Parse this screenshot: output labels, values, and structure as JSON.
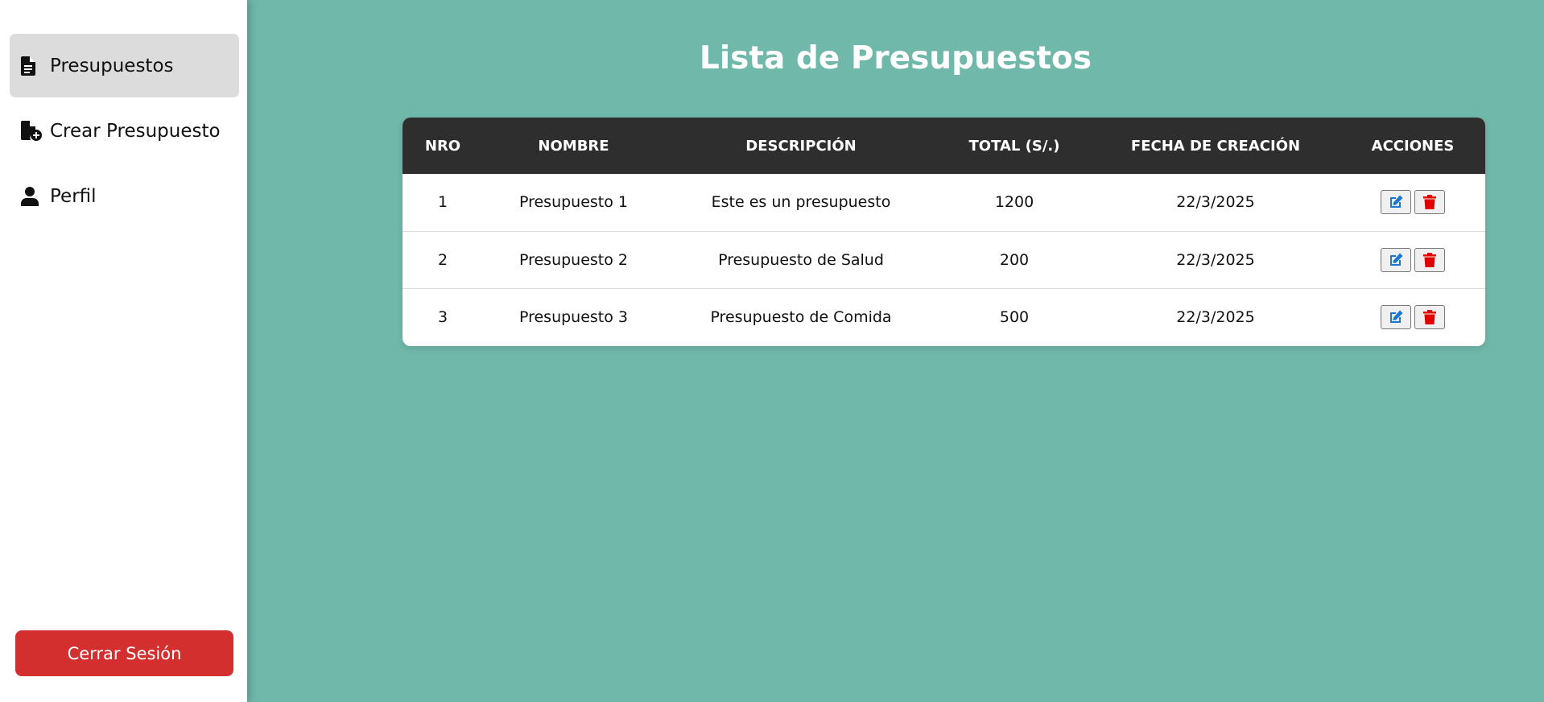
{
  "sidebar": {
    "items": [
      {
        "label": "Presupuestos",
        "icon": "file-lines-icon",
        "active": true
      },
      {
        "label": "Crear Presupuesto",
        "icon": "file-circle-plus-icon",
        "active": false
      },
      {
        "label": "Perfil",
        "icon": "user-icon",
        "active": false
      }
    ],
    "logout_label": "Cerrar Sesión"
  },
  "main": {
    "title": "Lista de Presupuestos",
    "table": {
      "headers": [
        "NRO",
        "NOMBRE",
        "DESCRIPCIÓN",
        "TOTAL (S/.)",
        "FECHA DE CREACIÓN",
        "ACCIONES"
      ],
      "rows": [
        {
          "nro": "1",
          "nombre": "Presupuesto 1",
          "descripcion": "Este es un presupuesto",
          "total": "1200",
          "fecha": "22/3/2025"
        },
        {
          "nro": "2",
          "nombre": "Presupuesto 2",
          "descripcion": "Presupuesto de Salud",
          "total": "200",
          "fecha": "22/3/2025"
        },
        {
          "nro": "3",
          "nombre": "Presupuesto 3",
          "descripcion": "Presupuesto de Comida",
          "total": "500",
          "fecha": "22/3/2025"
        }
      ],
      "row_actions": [
        {
          "icon": "edit-icon",
          "color": "#1976d2"
        },
        {
          "icon": "trash-icon",
          "color": "#e00000"
        }
      ]
    }
  },
  "colors": {
    "background": "#70b8aa",
    "sidebar": "#ffffff",
    "active_item": "#dcdcdc",
    "header": "#2e2e2e",
    "logout": "#d32f2f"
  }
}
